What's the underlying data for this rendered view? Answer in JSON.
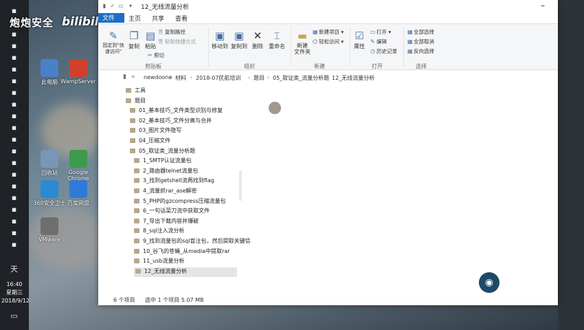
{
  "watermark": {
    "brand": "炮炮安全",
    "site": "bilibili"
  },
  "taskbar": {
    "icons": [
      "browser-icon",
      "folder-icon",
      "app-icon",
      "app-icon",
      "app-icon",
      "app-icon",
      "app-icon",
      "app-icon",
      "app-icon",
      "app-icon",
      "app-icon",
      "app-icon",
      "app-icon",
      "app-icon",
      "app-icon",
      "app-icon",
      "app-icon",
      "app-icon",
      "app-icon",
      "app-icon",
      "app-icon"
    ],
    "tray_lang": "天",
    "time": "16:40",
    "weekday": "星期三",
    "date": "2018/9/12"
  },
  "desktop": {
    "icons": [
      {
        "label": "此电脑",
        "color": "#4a80c8"
      },
      {
        "label": "WampServer",
        "color": "#d0402c"
      },
      {
        "label": "回收站",
        "color": "#7a95b5"
      },
      {
        "label": "Google Chrome",
        "color": "#3d9b4c"
      },
      {
        "label": "360安全卫士",
        "color": "#2a8ad4"
      },
      {
        "label": "百度网盘",
        "color": "#2f7ad8"
      },
      {
        "label": "VMware",
        "color": "#6e6e6e"
      }
    ]
  },
  "window": {
    "title": "12_无线流量分析",
    "tabs": {
      "file": "文件",
      "home": "主页",
      "share": "共享",
      "view": "查看"
    },
    "ribbon": {
      "pin": "固定到\"快速访问\"",
      "copy": "复制",
      "paste": "粘贴",
      "copy_path": "复制路径",
      "paste_shortcut": "粘贴快捷方式",
      "cut": "剪切",
      "move_to": "移动到",
      "copy_to": "复制到",
      "delete": "删除",
      "rename": "重命名",
      "new_folder": "新建\n文件夹",
      "new_item": "新建项目",
      "easy_access": "轻松访问",
      "properties": "属性",
      "open": "打开",
      "edit": "编辑",
      "history": "历史记录",
      "select_all": "全部选择",
      "select_none": "全部取消",
      "invert": "反向选择",
      "group_clipboard": "剪贴板",
      "group_organize": "组织",
      "group_new": "新建",
      "group_open": "打开",
      "group_select": "选择"
    },
    "breadcrumb": [
      "newdoone",
      "材料",
      "2018-07民航培训",
      "题目",
      "05_取证类_流量分析题",
      "12_无线流量分析"
    ],
    "tree": [
      {
        "label": "工具",
        "indent": 0
      },
      {
        "label": "题目",
        "indent": 0
      },
      {
        "label": "01_基本技巧_文件类型识别与修复",
        "indent": 1
      },
      {
        "label": "02_基本技巧_文件分离与合并",
        "indent": 1
      },
      {
        "label": "03_图片文件隐写",
        "indent": 1
      },
      {
        "label": "04_压缩文件",
        "indent": 1
      },
      {
        "label": "05_取证类_流量分析题",
        "indent": 1
      },
      {
        "label": "1_SMTP认证流量包",
        "indent": 2
      },
      {
        "label": "2_路由器telnet流量包",
        "indent": 2
      },
      {
        "label": "3_找到getshell流再找到flag",
        "indent": 2
      },
      {
        "label": "4_流量抓rar_ase解密",
        "indent": 2
      },
      {
        "label": "5_PHP的gzcompress压缩流量包",
        "indent": 2
      },
      {
        "label": "6_一句话菜刀流中获取文件",
        "indent": 2
      },
      {
        "label": "7_导出下载内容并爆破",
        "indent": 2
      },
      {
        "label": "8_sql注入流分析",
        "indent": 2
      },
      {
        "label": "9_找到流量包的sql盲注包，然后提取关键信",
        "indent": 2
      },
      {
        "label": "10_谷飞的苍蝇_从media中提取rar",
        "indent": 2
      },
      {
        "label": "11_usb流量分析",
        "indent": 2
      },
      {
        "label": "12_无线流量分析",
        "indent": 2,
        "selected": true
      }
    ],
    "status": {
      "count": "6 个项目",
      "selected": "选中 1 个项目  5.07 MB"
    }
  }
}
